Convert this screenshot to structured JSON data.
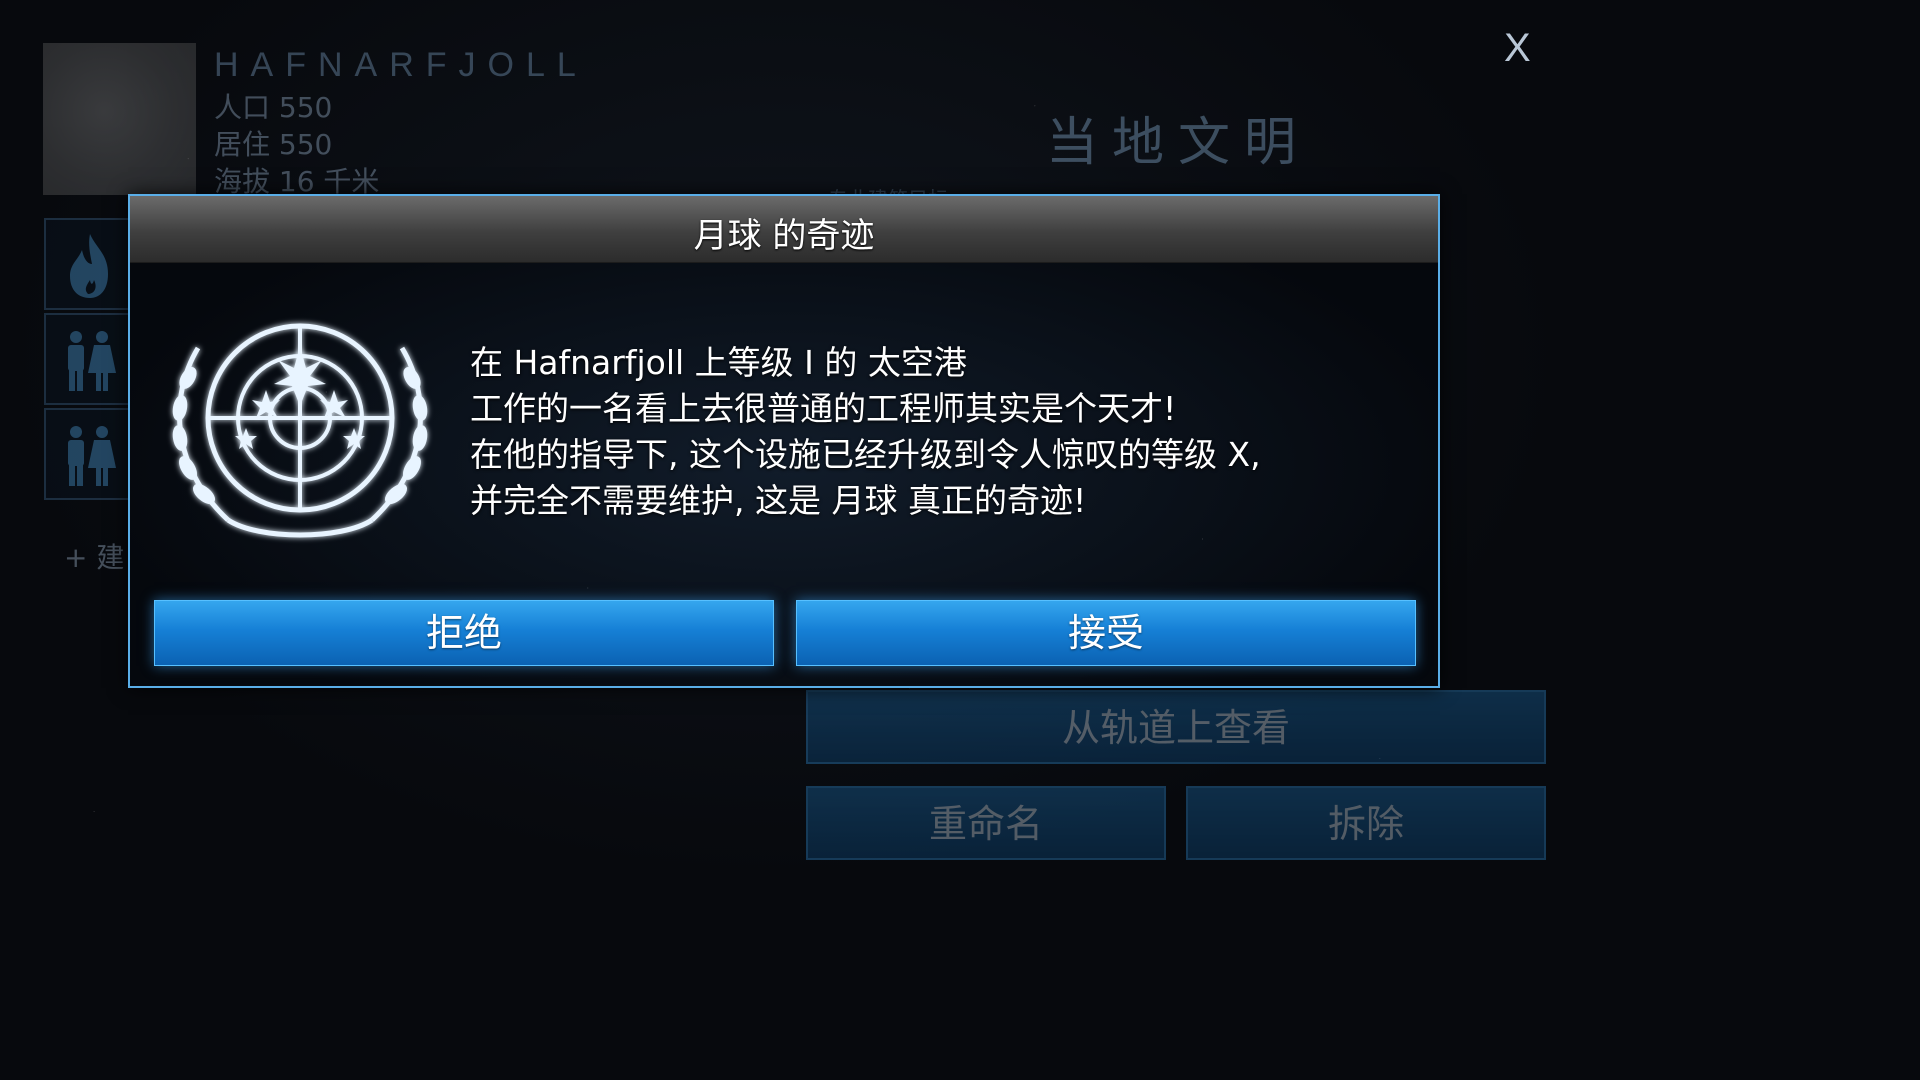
{
  "planet": {
    "name": "HAFNARFJOLL",
    "population": "人口 550",
    "housing": "居住 550",
    "altitude": "海拔 16 千米"
  },
  "window": {
    "close_label": "X"
  },
  "civilization": {
    "title": "当地文明",
    "hint": "专业建筑目标"
  },
  "side_tabs": [
    {
      "icon": "flame-icon"
    },
    {
      "icon": "people-icon"
    },
    {
      "icon": "people-icon"
    }
  ],
  "add_building_label": "+ 建",
  "actions": {
    "view_from_orbit": "从轨道上查看",
    "rename": "重命名",
    "demolish": "拆除"
  },
  "modal": {
    "title": "月球 的奇迹",
    "message_lines": [
      "在 Hafnarfjoll 上等级 I 的 太空港",
      "工作的一名看上去很普通的工程师其实是个天才!",
      "在他的指导下, 这个设施已经升级到令人惊叹的等级 X,",
      "并完全不需要维护, 这是 月球 真正的奇迹!"
    ],
    "reject_label": "拒绝",
    "accept_label": "接受",
    "emblem_icon": "united-nations-emblem-icon"
  },
  "colors": {
    "accent": "#1680d6",
    "modal_border": "#5aaee8",
    "emblem": "#e8f4ff"
  }
}
